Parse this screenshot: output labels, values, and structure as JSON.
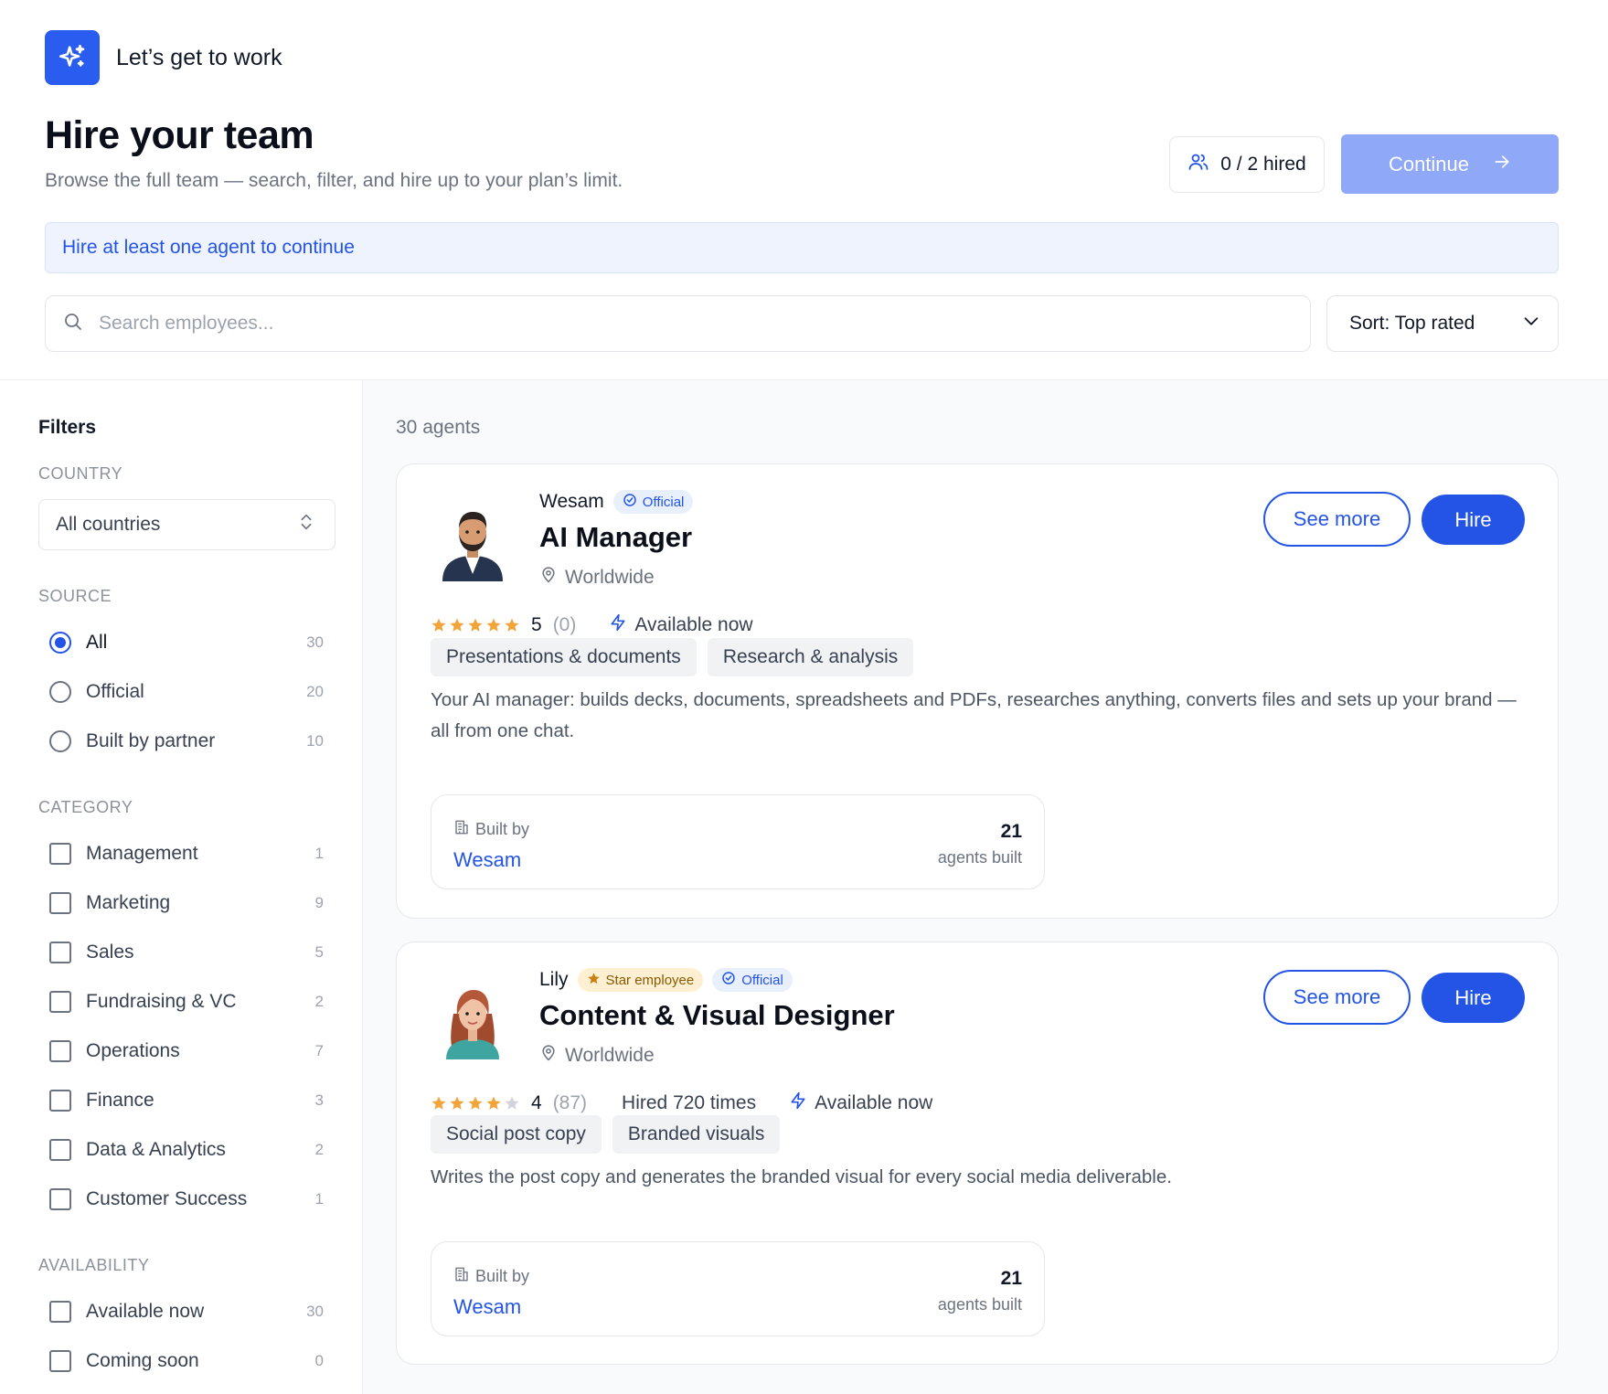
{
  "header": {
    "brand_text": "Let’s get to work",
    "title": "Hire your team",
    "subtitle": "Browse the full team — search, filter, and hire up to your plan’s limit.",
    "hired_label": "0 / 2 hired",
    "continue_label": "Continue"
  },
  "notice": "Hire at least one agent to continue",
  "search": {
    "placeholder": "Search employees..."
  },
  "sort": {
    "label": "Sort: Top rated"
  },
  "filters": {
    "title": "Filters",
    "country": {
      "title": "COUNTRY",
      "value": "All countries"
    },
    "source": {
      "title": "SOURCE",
      "options": [
        {
          "label": "All",
          "count": "30",
          "checked": true
        },
        {
          "label": "Official",
          "count": "20",
          "checked": false
        },
        {
          "label": "Built by partner",
          "count": "10",
          "checked": false
        }
      ]
    },
    "category": {
      "title": "CATEGORY",
      "options": [
        {
          "label": "Management",
          "count": "1"
        },
        {
          "label": "Marketing",
          "count": "9"
        },
        {
          "label": "Sales",
          "count": "5"
        },
        {
          "label": "Fundraising & VC",
          "count": "2"
        },
        {
          "label": "Operations",
          "count": "7"
        },
        {
          "label": "Finance",
          "count": "3"
        },
        {
          "label": "Data & Analytics",
          "count": "2"
        },
        {
          "label": "Customer Success",
          "count": "1"
        }
      ]
    },
    "availability": {
      "title": "AVAILABILITY",
      "options": [
        {
          "label": "Available now",
          "count": "30"
        },
        {
          "label": "Coming soon",
          "count": "0"
        }
      ]
    }
  },
  "results_count": "30 agents",
  "agents": [
    {
      "owner": "Wesam",
      "official_badge": "Official",
      "role": "AI Manager",
      "location": "Worldwide",
      "rating_value": "5",
      "rating_count": "(0)",
      "stars": 5,
      "availability": "Available now",
      "tags": [
        "Presentations & documents",
        "Research & analysis"
      ],
      "description": "Your AI manager: builds decks, documents, spreadsheets and PDFs, researches anything, converts files and sets up your brand — all from one chat.",
      "built_by_label": "Built by",
      "built_by_name": "Wesam",
      "agents_built": "21",
      "agents_built_label": "agents built",
      "see_more": "See more",
      "hire": "Hire"
    },
    {
      "owner": "Lily",
      "star_badge": "Star employee",
      "official_badge": "Official",
      "role": "Content & Visual Designer",
      "location": "Worldwide",
      "rating_value": "4",
      "rating_count": "(87)",
      "stars": 4,
      "hired_times": "Hired 720 times",
      "availability": "Available now",
      "tags": [
        "Social post copy",
        "Branded visuals"
      ],
      "description": "Writes the post copy and generates the branded visual for every social media deliverable.",
      "built_by_label": "Built by",
      "built_by_name": "Wesam",
      "agents_built": "21",
      "agents_built_label": "agents built",
      "see_more": "See more",
      "hire": "Hire"
    }
  ],
  "colors": {
    "accent": "#2354e6",
    "continue_disabled": "#8fa8f7",
    "star": "#f0a43a",
    "star_empty": "#d1d5db"
  },
  "icons": {
    "brand": "sparkles-icon",
    "hired": "users-icon",
    "continue": "arrow-right-icon",
    "search": "search-icon",
    "sort": "chevron-down-icon",
    "country": "chevron-up-down-icon",
    "official": "check-circle-icon",
    "star_badge": "star-icon",
    "location": "map-pin-icon",
    "availability": "lightning-icon",
    "built_by": "building-icon"
  }
}
